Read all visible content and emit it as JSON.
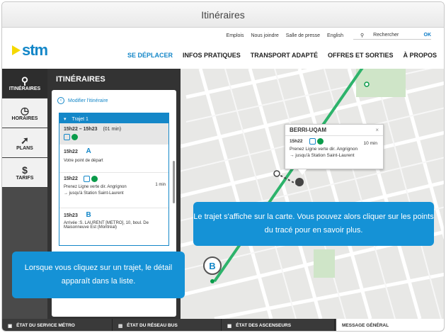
{
  "window": {
    "title": "Itinéraires"
  },
  "topnav": {
    "links": [
      "Emplois",
      "Nous joindre",
      "Salle de presse",
      "English"
    ],
    "search_placeholder": "Rechercher",
    "search_button": "OK"
  },
  "logo": {
    "text": "stm"
  },
  "mainnav": {
    "items": [
      {
        "label": "SE DÉPLACER",
        "active": true
      },
      {
        "label": "INFOS PRATIQUES",
        "active": false
      },
      {
        "label": "TRANSPORT ADAPTÉ",
        "active": false
      },
      {
        "label": "OFFRES ET SORTIES",
        "active": false
      },
      {
        "label": "À PROPOS",
        "active": false
      }
    ]
  },
  "sidebar": {
    "items": [
      {
        "label": "ITINÉRAIRES",
        "icon": "pin-icon"
      },
      {
        "label": "HORAIRES",
        "icon": "clock-icon"
      },
      {
        "label": "PLANS",
        "icon": "arrow-icon"
      },
      {
        "label": "TARIFS",
        "icon": "dollar-icon"
      }
    ]
  },
  "panel": {
    "title": "ITINÉRAIRES",
    "modify_label": "Modifier l'itinéraire",
    "trip": {
      "label": "Trajet 1",
      "time_range": "15h22 – 15h23",
      "duration": "(01 min)",
      "steps": [
        {
          "time": "15h22",
          "letter": "A",
          "text": "Votre point de départ"
        },
        {
          "time": "15h22",
          "text": "Prenez Ligne verte dir. Angrignon",
          "sub": "→ jusqu'à Station Saint-Laurent",
          "duration": "1 min"
        },
        {
          "time": "15h23",
          "letter": "B",
          "text": "Arrivée :S. LAURENT [METRO], 10, boul. De Maisonneuve Est (Montréal)"
        }
      ]
    }
  },
  "popup": {
    "title": "BERRI-UQAM",
    "close": "×",
    "time": "15h22",
    "duration": "10 min",
    "text": "Prenez Ligne verte dir. Angrignon",
    "sub": "→ jusqu'à Station Saint-Laurent"
  },
  "callouts": {
    "map": "Le trajet s'affiche sur la carte. Vous pouvez alors cliquer sur les points du tracé pour en savoir plus.",
    "list": "Lorsque vous cliquez sur un trajet, le détail apparaît dans la liste."
  },
  "bottombar": {
    "items": [
      "ÉTAT DU SERVICE MÉTRO",
      "ÉTAT DU RÉSEAU BUS",
      "ÉTAT DES ASCENSEURS"
    ],
    "message": "MESSAGE GÉNÉRAL"
  },
  "colors": {
    "accent": "#1487c8",
    "green_line": "#0a9b4a",
    "yellow": "#f5d800"
  }
}
